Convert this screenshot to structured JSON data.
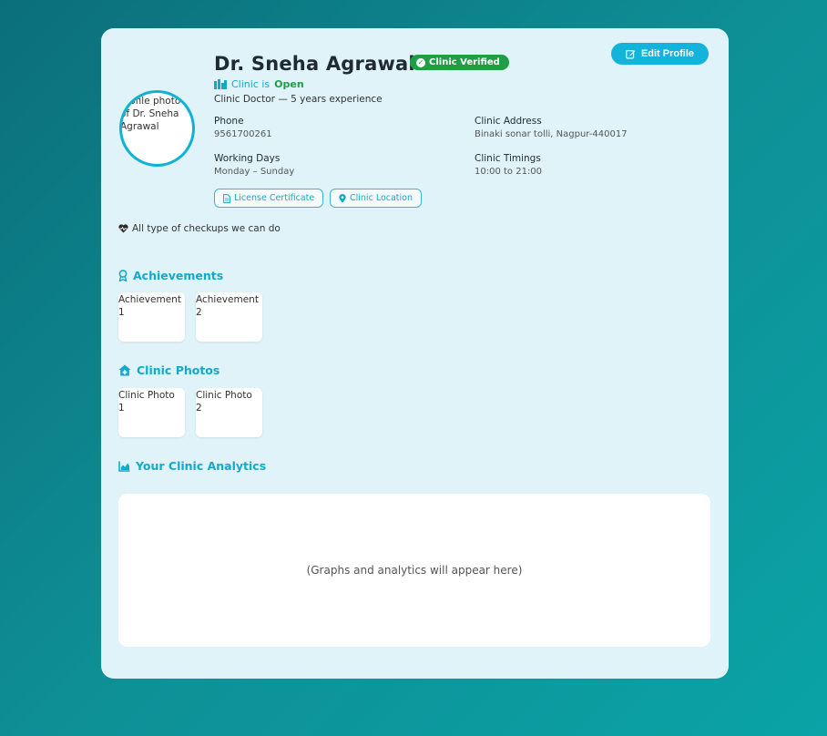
{
  "profile": {
    "name": "Dr. Sneha Agrawal",
    "verified_label": "Clinic Verified",
    "edit_label": "Edit Profile",
    "status_prefix": "Clinic is",
    "status_value": "Open",
    "subtitle": "Clinic Doctor — 5 years experience",
    "avatar_alt": "Profile photo of Dr. Sneha Agrawal",
    "avatar_lines": "Profile photo\nof Dr. Sneha\nAgrawal"
  },
  "details": {
    "phone_label": "Phone",
    "phone_value": "9561700261",
    "address_label": "Clinic Address",
    "address_value": "Binaki sonar tolli, Nagpur-440017",
    "days_label": "Working Days",
    "days_value": "Monday – Sunday",
    "timings_label": "Clinic Timings",
    "timings_value": "10:00 to 21:00"
  },
  "links": {
    "license": "License Certificate",
    "location": "Clinic Location"
  },
  "note": "All type of checkups we can do",
  "achievements": {
    "title": "Achievements",
    "items": [
      "Achievement\n1",
      "Achievement\n2"
    ]
  },
  "photos": {
    "title": "Clinic Photos",
    "items": [
      "Clinic Photo\n1",
      "Clinic Photo\n2"
    ]
  },
  "analytics": {
    "title": "Your Clinic Analytics",
    "placeholder": "(Graphs and analytics will appear here)"
  },
  "colors": {
    "accent": "#14b3dc",
    "verified": "#1f9e45",
    "card": "#dff3f8"
  },
  "icons": {
    "verified": "check-circle-icon",
    "edit": "edit-icon",
    "status": "clinic-icon",
    "license": "document-icon",
    "location": "map-pin-icon",
    "note": "heart-pulse-icon",
    "achievements": "award-icon",
    "photos": "clinic-house-icon",
    "analytics": "chart-area-icon"
  }
}
